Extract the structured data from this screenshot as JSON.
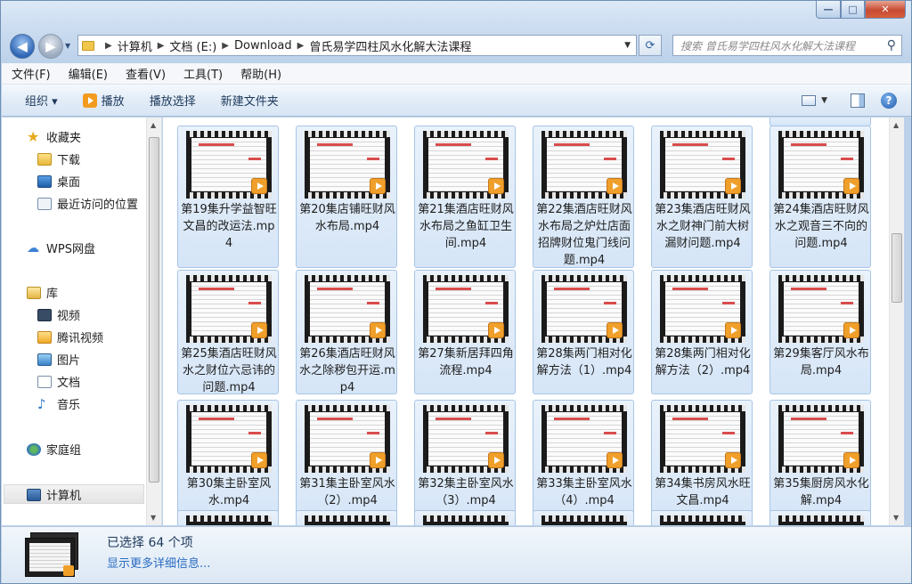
{
  "address": {
    "crumbs": [
      "计算机",
      "文档 (E:)",
      "Download",
      "曾氏易学四柱风水化解大法课程"
    ]
  },
  "search": {
    "placeholder": "搜索 曾氏易学四柱风水化解大法课程"
  },
  "menu": [
    "文件(F)",
    "编辑(E)",
    "查看(V)",
    "工具(T)",
    "帮助(H)"
  ],
  "toolbar": {
    "organize": "组织 ▾",
    "play": "播放",
    "play_selection": "播放选择",
    "new_folder": "新建文件夹"
  },
  "nav": {
    "favorites": "收藏夹",
    "downloads": "下载",
    "desktop": "桌面",
    "recent": "最近访问的位置",
    "wps": "WPS网盘",
    "library": "库",
    "video": "视频",
    "tencent_video": "腾讯视频",
    "pictures": "图片",
    "documents": "文档",
    "music": "音乐",
    "homegroup": "家庭组",
    "computer": "计算机"
  },
  "files": [
    "第19集升学益智旺文昌的改运法.mp4",
    "第20集店铺旺财风水布局.mp4",
    "第21集酒店旺财风水布局之鱼缸卫生间.mp4",
    "第22集酒店旺财风水布局之炉灶店面招牌财位鬼门线问题.mp4",
    "第23集酒店旺财风水之财神门前大树漏财问题.mp4",
    "第24集酒店旺财风水之观音三不向的问题.mp4",
    "第25集酒店旺财风水之财位六忌讳的问题.mp4",
    "第26集酒店旺财风水之除秽包开运.mp4",
    "第27集新居拜四角流程.mp4",
    "第28集两门相对化解方法（1）.mp4",
    "第28集两门相对化解方法（2）.mp4",
    "第29集客厅风水布局.mp4",
    "第30集主卧室风水.mp4",
    "第31集主卧室风水（2）.mp4",
    "第32集主卧室风水（3）.mp4",
    "第33集主卧室风水（4）.mp4",
    "第34集书房风水旺文昌.mp4",
    "第35集厨房风水化解.mp4"
  ],
  "details": {
    "selected": "已选择 64 个项",
    "more": "显示更多详细信息..."
  }
}
